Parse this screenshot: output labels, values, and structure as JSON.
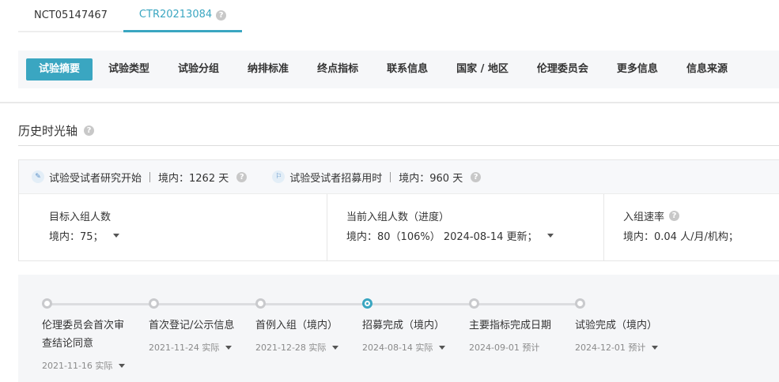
{
  "id_tabs": [
    {
      "label": "NCT05147467"
    },
    {
      "label": "CTR20213084"
    }
  ],
  "nav": [
    "试验摘要",
    "试验类型",
    "试验分组",
    "纳排标准",
    "终点指标",
    "联系信息",
    "国家 / 地区",
    "伦理委员会",
    "更多信息",
    "信息来源"
  ],
  "section": {
    "title": "历史时光轴"
  },
  "stats": {
    "study_start_label": "试验受试者研究开始",
    "study_start_value": "境内：1262 天",
    "recruit_label": "试验受试者招募用时",
    "recruit_value": "境内：960 天",
    "target_title": "目标入组人数",
    "target_value": "境内：75；",
    "current_title": "当前入组人数（进度）",
    "current_value": "境内：80（106%） 2024-08-14 更新；",
    "rate_title": "入组速率",
    "rate_value": "境内：0.04 人/月/机构；"
  },
  "timeline": [
    {
      "label": "伦理委员会首次审查结论同意",
      "date": "2021-11-16 实际",
      "dropdown": true
    },
    {
      "label": "首次登记/公示信息",
      "date": "2021-11-24 实际",
      "dropdown": true
    },
    {
      "label": "首例入组（境内）",
      "date": "2021-12-28 实际",
      "dropdown": true
    },
    {
      "label": "招募完成（境内）",
      "date": "2024-08-14 实际",
      "dropdown": true,
      "current": true
    },
    {
      "label": "主要指标完成日期",
      "date": "2024-09-01 预计",
      "dropdown": false
    },
    {
      "label": "试验完成（境内）",
      "date": "2024-12-01 预计",
      "dropdown": true
    }
  ],
  "colors": {
    "accent": "#3aa6c1"
  },
  "icons": {
    "help": "question-circle-icon",
    "start": "pen-icon",
    "recruit": "flag-icon",
    "dropdown": "caret-down-icon"
  }
}
